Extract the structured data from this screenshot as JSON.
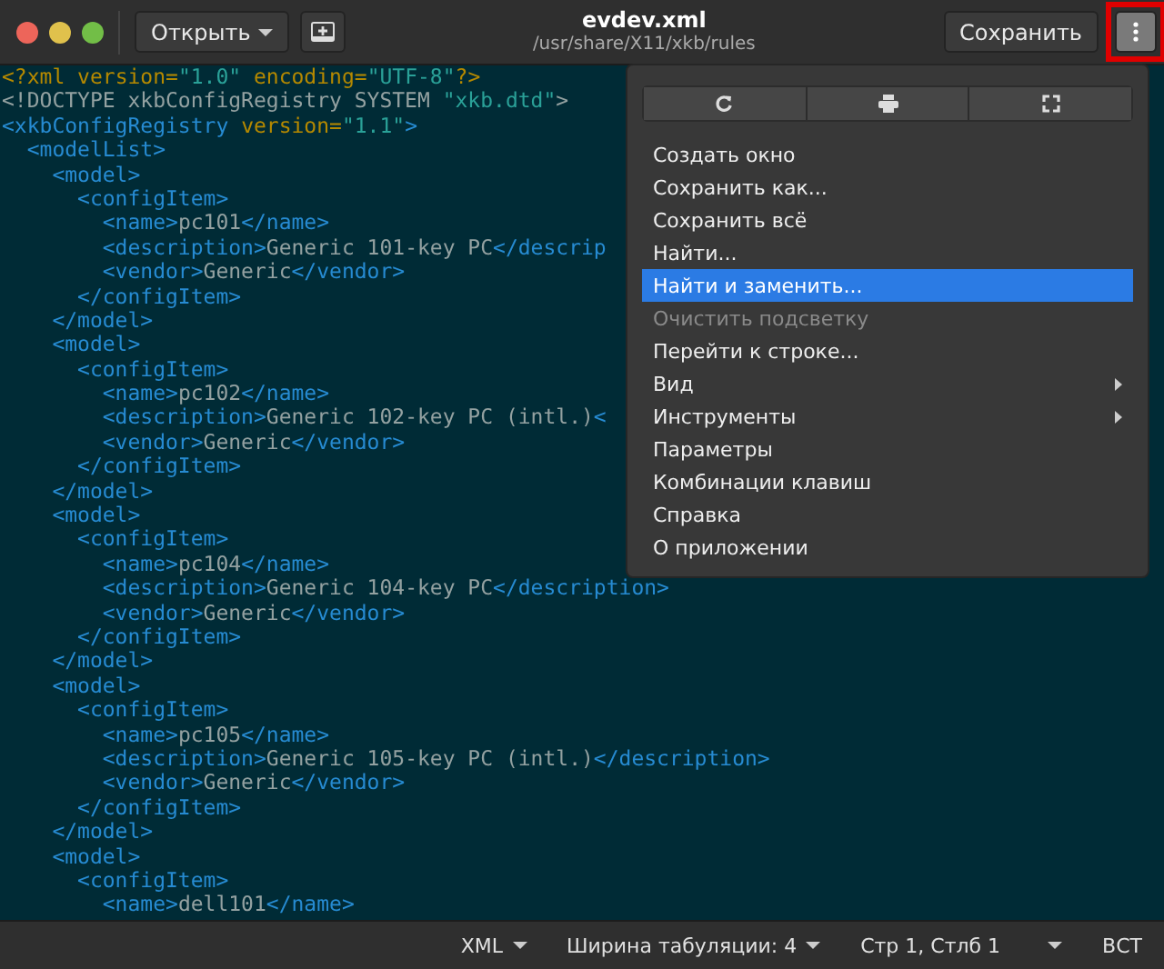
{
  "window": {
    "title": "evdev.xml",
    "subtitle": "/usr/share/X11/xkb/rules"
  },
  "header": {
    "open_button": "Открыть",
    "save_button": "Сохранить",
    "menu_button": {
      "pressed": true,
      "annotated": true
    }
  },
  "editor": {
    "lines": [
      [
        {
          "kind": "pi",
          "text": "<?xml "
        },
        {
          "kind": "attr",
          "text": "version="
        },
        {
          "kind": "string",
          "text": "\"1.0\""
        },
        {
          "kind": "attr",
          "text": " encoding="
        },
        {
          "kind": "string",
          "text": "\"UTF-8\""
        },
        {
          "kind": "pi",
          "text": "?>"
        }
      ],
      [
        {
          "kind": "text",
          "text": "<!DOCTYPE xkbConfigRegistry SYSTEM "
        },
        {
          "kind": "string",
          "text": "\"xkb.dtd\""
        },
        {
          "kind": "text",
          "text": ">"
        }
      ],
      [
        {
          "kind": "tag",
          "text": "<xkbConfigRegistry "
        },
        {
          "kind": "attr",
          "text": "version="
        },
        {
          "kind": "string",
          "text": "\"1.1\""
        },
        {
          "kind": "tag",
          "text": ">"
        }
      ],
      [
        {
          "kind": "tag",
          "text": "  <modelList>"
        }
      ],
      [
        {
          "kind": "tag",
          "text": "    <model>"
        }
      ],
      [
        {
          "kind": "tag",
          "text": "      <configItem>"
        }
      ],
      [
        {
          "kind": "tag",
          "text": "        <name>"
        },
        {
          "kind": "text",
          "text": "pc101"
        },
        {
          "kind": "tag",
          "text": "</name>"
        }
      ],
      [
        {
          "kind": "tag",
          "text": "        <description>"
        },
        {
          "kind": "text",
          "text": "Generic 101-key PC"
        },
        {
          "kind": "tag",
          "text": "</descrip"
        }
      ],
      [
        {
          "kind": "tag",
          "text": "        <vendor>"
        },
        {
          "kind": "text",
          "text": "Generic"
        },
        {
          "kind": "tag",
          "text": "</vendor>"
        }
      ],
      [
        {
          "kind": "tag",
          "text": "      </configItem>"
        }
      ],
      [
        {
          "kind": "tag",
          "text": "    </model>"
        }
      ],
      [
        {
          "kind": "tag",
          "text": "    <model>"
        }
      ],
      [
        {
          "kind": "tag",
          "text": "      <configItem>"
        }
      ],
      [
        {
          "kind": "tag",
          "text": "        <name>"
        },
        {
          "kind": "text",
          "text": "pc102"
        },
        {
          "kind": "tag",
          "text": "</name>"
        }
      ],
      [
        {
          "kind": "tag",
          "text": "        <description>"
        },
        {
          "kind": "text",
          "text": "Generic 102-key PC (intl.)"
        },
        {
          "kind": "tag",
          "text": "<"
        }
      ],
      [
        {
          "kind": "tag",
          "text": "        <vendor>"
        },
        {
          "kind": "text",
          "text": "Generic"
        },
        {
          "kind": "tag",
          "text": "</vendor>"
        }
      ],
      [
        {
          "kind": "tag",
          "text": "      </configItem>"
        }
      ],
      [
        {
          "kind": "tag",
          "text": "    </model>"
        }
      ],
      [
        {
          "kind": "tag",
          "text": "    <model>"
        }
      ],
      [
        {
          "kind": "tag",
          "text": "      <configItem>"
        }
      ],
      [
        {
          "kind": "tag",
          "text": "        <name>"
        },
        {
          "kind": "text",
          "text": "pc104"
        },
        {
          "kind": "tag",
          "text": "</name>"
        }
      ],
      [
        {
          "kind": "tag",
          "text": "        <description>"
        },
        {
          "kind": "text",
          "text": "Generic 104-key PC"
        },
        {
          "kind": "tag",
          "text": "</description>"
        }
      ],
      [
        {
          "kind": "tag",
          "text": "        <vendor>"
        },
        {
          "kind": "text",
          "text": "Generic"
        },
        {
          "kind": "tag",
          "text": "</vendor>"
        }
      ],
      [
        {
          "kind": "tag",
          "text": "      </configItem>"
        }
      ],
      [
        {
          "kind": "tag",
          "text": "    </model>"
        }
      ],
      [
        {
          "kind": "tag",
          "text": "    <model>"
        }
      ],
      [
        {
          "kind": "tag",
          "text": "      <configItem>"
        }
      ],
      [
        {
          "kind": "tag",
          "text": "        <name>"
        },
        {
          "kind": "text",
          "text": "pc105"
        },
        {
          "kind": "tag",
          "text": "</name>"
        }
      ],
      [
        {
          "kind": "tag",
          "text": "        <description>"
        },
        {
          "kind": "text",
          "text": "Generic 105-key PC (intl.)"
        },
        {
          "kind": "tag",
          "text": "</description>"
        }
      ],
      [
        {
          "kind": "tag",
          "text": "        <vendor>"
        },
        {
          "kind": "text",
          "text": "Generic"
        },
        {
          "kind": "tag",
          "text": "</vendor>"
        }
      ],
      [
        {
          "kind": "tag",
          "text": "      </configItem>"
        }
      ],
      [
        {
          "kind": "tag",
          "text": "    </model>"
        }
      ],
      [
        {
          "kind": "tag",
          "text": "    <model>"
        }
      ],
      [
        {
          "kind": "tag",
          "text": "      <configItem>"
        }
      ],
      [
        {
          "kind": "tag",
          "text": "        <name>"
        },
        {
          "kind": "text",
          "text": "dell101"
        },
        {
          "kind": "tag",
          "text": "</name>"
        }
      ]
    ]
  },
  "menu": {
    "toolbar": [
      {
        "kind": "reload"
      },
      {
        "kind": "print"
      },
      {
        "kind": "fullscreen"
      }
    ],
    "items": [
      {
        "label": "Создать окно",
        "selected": false,
        "disabled": false,
        "submenu": false
      },
      {
        "label": "Сохранить как...",
        "selected": false,
        "disabled": false,
        "submenu": false
      },
      {
        "label": "Сохранить всё",
        "selected": false,
        "disabled": false,
        "submenu": false
      },
      {
        "label": "Найти...",
        "selected": false,
        "disabled": false,
        "submenu": false
      },
      {
        "label": "Найти и заменить...",
        "selected": true,
        "disabled": false,
        "submenu": false
      },
      {
        "label": "Очистить подсветку",
        "selected": false,
        "disabled": true,
        "submenu": false
      },
      {
        "label": "Перейти к строке...",
        "selected": false,
        "disabled": false,
        "submenu": false
      },
      {
        "label": "Вид",
        "selected": false,
        "disabled": false,
        "submenu": true
      },
      {
        "label": "Инструменты",
        "selected": false,
        "disabled": false,
        "submenu": true
      },
      {
        "label": "Параметры",
        "selected": false,
        "disabled": false,
        "submenu": false
      },
      {
        "label": "Комбинации клавиш",
        "selected": false,
        "disabled": false,
        "submenu": false
      },
      {
        "label": "Справка",
        "selected": false,
        "disabled": false,
        "submenu": false
      },
      {
        "label": "О приложении",
        "selected": false,
        "disabled": false,
        "submenu": false
      }
    ]
  },
  "status_bar": [
    {
      "label": "XML",
      "dropdown": true
    },
    {
      "label": "Ширина табуляции: 4",
      "dropdown": true
    },
    {
      "label": "Стр 1, Стлб 1",
      "dropdown": true
    },
    {
      "label": "ВСТ",
      "dropdown": false
    }
  ]
}
